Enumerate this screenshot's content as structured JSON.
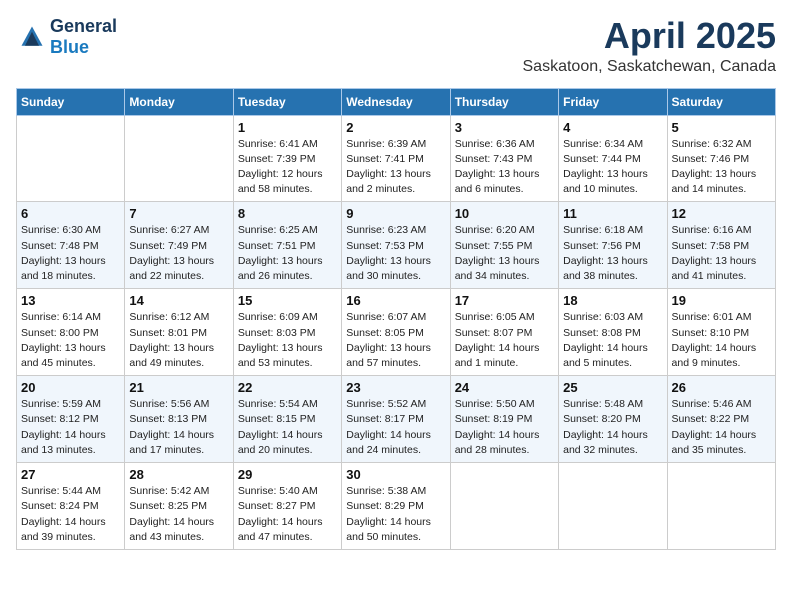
{
  "header": {
    "logo_general": "General",
    "logo_blue": "Blue",
    "month": "April 2025",
    "location": "Saskatoon, Saskatchewan, Canada"
  },
  "days_of_week": [
    "Sunday",
    "Monday",
    "Tuesday",
    "Wednesday",
    "Thursday",
    "Friday",
    "Saturday"
  ],
  "weeks": [
    [
      {
        "day": "",
        "content": ""
      },
      {
        "day": "",
        "content": ""
      },
      {
        "day": "1",
        "content": "Sunrise: 6:41 AM\nSunset: 7:39 PM\nDaylight: 12 hours and 58 minutes."
      },
      {
        "day": "2",
        "content": "Sunrise: 6:39 AM\nSunset: 7:41 PM\nDaylight: 13 hours and 2 minutes."
      },
      {
        "day": "3",
        "content": "Sunrise: 6:36 AM\nSunset: 7:43 PM\nDaylight: 13 hours and 6 minutes."
      },
      {
        "day": "4",
        "content": "Sunrise: 6:34 AM\nSunset: 7:44 PM\nDaylight: 13 hours and 10 minutes."
      },
      {
        "day": "5",
        "content": "Sunrise: 6:32 AM\nSunset: 7:46 PM\nDaylight: 13 hours and 14 minutes."
      }
    ],
    [
      {
        "day": "6",
        "content": "Sunrise: 6:30 AM\nSunset: 7:48 PM\nDaylight: 13 hours and 18 minutes."
      },
      {
        "day": "7",
        "content": "Sunrise: 6:27 AM\nSunset: 7:49 PM\nDaylight: 13 hours and 22 minutes."
      },
      {
        "day": "8",
        "content": "Sunrise: 6:25 AM\nSunset: 7:51 PM\nDaylight: 13 hours and 26 minutes."
      },
      {
        "day": "9",
        "content": "Sunrise: 6:23 AM\nSunset: 7:53 PM\nDaylight: 13 hours and 30 minutes."
      },
      {
        "day": "10",
        "content": "Sunrise: 6:20 AM\nSunset: 7:55 PM\nDaylight: 13 hours and 34 minutes."
      },
      {
        "day": "11",
        "content": "Sunrise: 6:18 AM\nSunset: 7:56 PM\nDaylight: 13 hours and 38 minutes."
      },
      {
        "day": "12",
        "content": "Sunrise: 6:16 AM\nSunset: 7:58 PM\nDaylight: 13 hours and 41 minutes."
      }
    ],
    [
      {
        "day": "13",
        "content": "Sunrise: 6:14 AM\nSunset: 8:00 PM\nDaylight: 13 hours and 45 minutes."
      },
      {
        "day": "14",
        "content": "Sunrise: 6:12 AM\nSunset: 8:01 PM\nDaylight: 13 hours and 49 minutes."
      },
      {
        "day": "15",
        "content": "Sunrise: 6:09 AM\nSunset: 8:03 PM\nDaylight: 13 hours and 53 minutes."
      },
      {
        "day": "16",
        "content": "Sunrise: 6:07 AM\nSunset: 8:05 PM\nDaylight: 13 hours and 57 minutes."
      },
      {
        "day": "17",
        "content": "Sunrise: 6:05 AM\nSunset: 8:07 PM\nDaylight: 14 hours and 1 minute."
      },
      {
        "day": "18",
        "content": "Sunrise: 6:03 AM\nSunset: 8:08 PM\nDaylight: 14 hours and 5 minutes."
      },
      {
        "day": "19",
        "content": "Sunrise: 6:01 AM\nSunset: 8:10 PM\nDaylight: 14 hours and 9 minutes."
      }
    ],
    [
      {
        "day": "20",
        "content": "Sunrise: 5:59 AM\nSunset: 8:12 PM\nDaylight: 14 hours and 13 minutes."
      },
      {
        "day": "21",
        "content": "Sunrise: 5:56 AM\nSunset: 8:13 PM\nDaylight: 14 hours and 17 minutes."
      },
      {
        "day": "22",
        "content": "Sunrise: 5:54 AM\nSunset: 8:15 PM\nDaylight: 14 hours and 20 minutes."
      },
      {
        "day": "23",
        "content": "Sunrise: 5:52 AM\nSunset: 8:17 PM\nDaylight: 14 hours and 24 minutes."
      },
      {
        "day": "24",
        "content": "Sunrise: 5:50 AM\nSunset: 8:19 PM\nDaylight: 14 hours and 28 minutes."
      },
      {
        "day": "25",
        "content": "Sunrise: 5:48 AM\nSunset: 8:20 PM\nDaylight: 14 hours and 32 minutes."
      },
      {
        "day": "26",
        "content": "Sunrise: 5:46 AM\nSunset: 8:22 PM\nDaylight: 14 hours and 35 minutes."
      }
    ],
    [
      {
        "day": "27",
        "content": "Sunrise: 5:44 AM\nSunset: 8:24 PM\nDaylight: 14 hours and 39 minutes."
      },
      {
        "day": "28",
        "content": "Sunrise: 5:42 AM\nSunset: 8:25 PM\nDaylight: 14 hours and 43 minutes."
      },
      {
        "day": "29",
        "content": "Sunrise: 5:40 AM\nSunset: 8:27 PM\nDaylight: 14 hours and 47 minutes."
      },
      {
        "day": "30",
        "content": "Sunrise: 5:38 AM\nSunset: 8:29 PM\nDaylight: 14 hours and 50 minutes."
      },
      {
        "day": "",
        "content": ""
      },
      {
        "day": "",
        "content": ""
      },
      {
        "day": "",
        "content": ""
      }
    ]
  ]
}
